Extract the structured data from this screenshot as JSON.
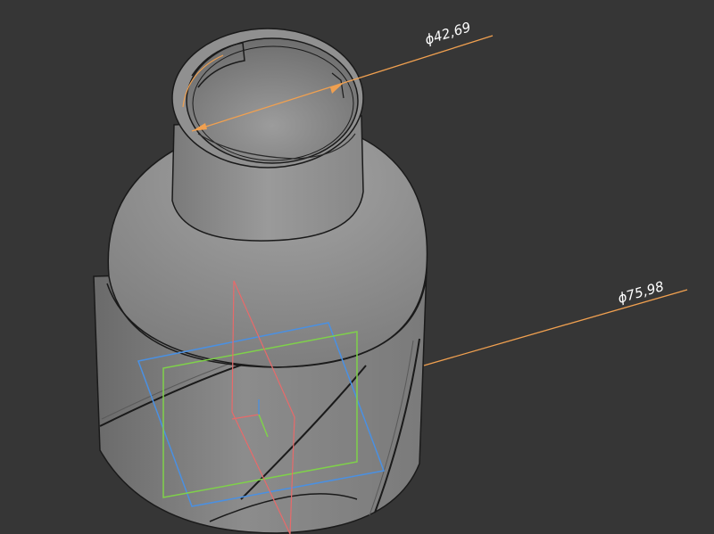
{
  "viewport": {
    "background": "#363636",
    "model_color": "#8a8a8a",
    "edge_color": "#1a1a1a"
  },
  "dimensions": [
    {
      "label": "ϕ42,69",
      "color": "#f0a050"
    },
    {
      "label": "ϕ75,98",
      "color": "#f0a050"
    }
  ],
  "datum_planes": [
    {
      "name": "xy-plane",
      "color": "#4a90e2"
    },
    {
      "name": "xz-plane",
      "color": "#7fd14a"
    },
    {
      "name": "yz-plane",
      "color": "#e86a6a"
    }
  ],
  "origin_axes": {
    "color": "#7fd14a"
  }
}
